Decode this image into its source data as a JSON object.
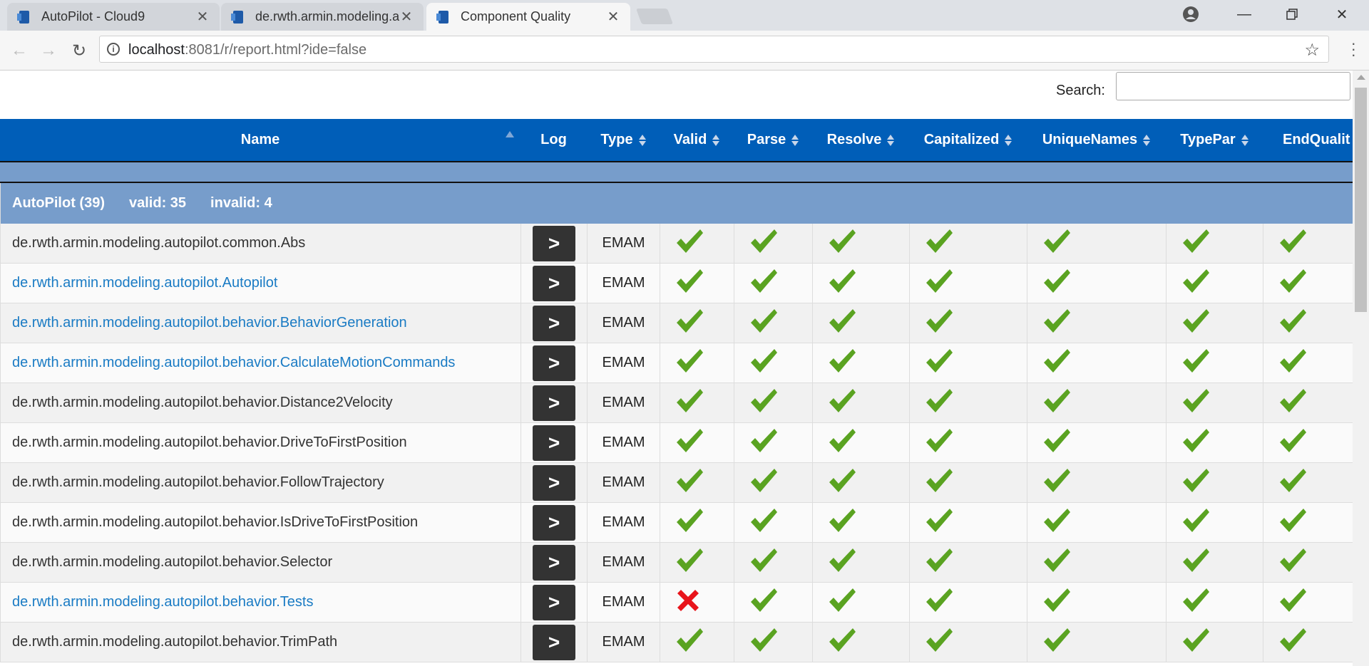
{
  "browser": {
    "tabs": [
      {
        "title": "AutoPilot - Cloud9",
        "active": false
      },
      {
        "title": "de.rwth.armin.modeling.a",
        "active": false
      },
      {
        "title": "Component Quality",
        "active": true
      }
    ],
    "url_host": "localhost",
    "url_path": ":8081/r/report.html?ide=false"
  },
  "search": {
    "label": "Search:",
    "value": ""
  },
  "table": {
    "columns": [
      "Name",
      "Log",
      "Type",
      "Valid",
      "Parse",
      "Resolve",
      "Capitalized",
      "UniqueNames",
      "TypePar",
      "EndQualit"
    ],
    "group": {
      "name": "AutoPilot (39)",
      "valid": "valid: 35",
      "invalid": "invalid: 4"
    },
    "log_label": ">",
    "rows": [
      {
        "name": "de.rwth.armin.modeling.autopilot.common.Abs",
        "link": false,
        "type": "EMAM",
        "checks": [
          "ok",
          "ok",
          "ok",
          "ok",
          "ok",
          "ok",
          "ok"
        ]
      },
      {
        "name": "de.rwth.armin.modeling.autopilot.Autopilot",
        "link": true,
        "type": "EMAM",
        "checks": [
          "ok",
          "ok",
          "ok",
          "ok",
          "ok",
          "ok",
          "ok"
        ]
      },
      {
        "name": "de.rwth.armin.modeling.autopilot.behavior.BehaviorGeneration",
        "link": true,
        "type": "EMAM",
        "checks": [
          "ok",
          "ok",
          "ok",
          "ok",
          "ok",
          "ok",
          "ok"
        ]
      },
      {
        "name": "de.rwth.armin.modeling.autopilot.behavior.CalculateMotionCommands",
        "link": true,
        "type": "EMAM",
        "checks": [
          "ok",
          "ok",
          "ok",
          "ok",
          "ok",
          "ok",
          "ok"
        ]
      },
      {
        "name": "de.rwth.armin.modeling.autopilot.behavior.Distance2Velocity",
        "link": false,
        "type": "EMAM",
        "checks": [
          "ok",
          "ok",
          "ok",
          "ok",
          "ok",
          "ok",
          "ok"
        ]
      },
      {
        "name": "de.rwth.armin.modeling.autopilot.behavior.DriveToFirstPosition",
        "link": false,
        "type": "EMAM",
        "checks": [
          "ok",
          "ok",
          "ok",
          "ok",
          "ok",
          "ok",
          "ok"
        ]
      },
      {
        "name": "de.rwth.armin.modeling.autopilot.behavior.FollowTrajectory",
        "link": false,
        "type": "EMAM",
        "checks": [
          "ok",
          "ok",
          "ok",
          "ok",
          "ok",
          "ok",
          "ok"
        ]
      },
      {
        "name": "de.rwth.armin.modeling.autopilot.behavior.IsDriveToFirstPosition",
        "link": false,
        "type": "EMAM",
        "checks": [
          "ok",
          "ok",
          "ok",
          "ok",
          "ok",
          "ok",
          "ok"
        ]
      },
      {
        "name": "de.rwth.armin.modeling.autopilot.behavior.Selector",
        "link": false,
        "type": "EMAM",
        "checks": [
          "ok",
          "ok",
          "ok",
          "ok",
          "ok",
          "ok",
          "ok"
        ]
      },
      {
        "name": "de.rwth.armin.modeling.autopilot.behavior.Tests",
        "link": true,
        "type": "EMAM",
        "checks": [
          "fail",
          "ok",
          "ok",
          "ok",
          "ok",
          "ok",
          "ok"
        ]
      },
      {
        "name": "de.rwth.armin.modeling.autopilot.behavior.TrimPath",
        "link": false,
        "type": "EMAM",
        "checks": [
          "ok",
          "ok",
          "ok",
          "ok",
          "ok",
          "ok",
          "ok"
        ]
      }
    ]
  },
  "colors": {
    "header": "#005eb8",
    "group": "#779dcb",
    "check": "#5aa321",
    "cross": "#e8141b",
    "link": "#1a7bc4"
  }
}
